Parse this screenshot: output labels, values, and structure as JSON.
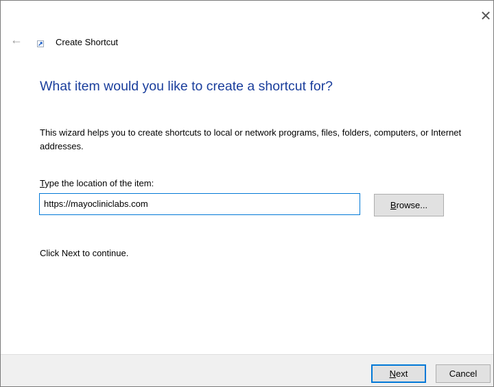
{
  "window": {
    "title": "Create Shortcut",
    "close_glyph": "✕",
    "back_glyph": "←"
  },
  "icons": {
    "back": "back-arrow-icon",
    "title": "shortcut-icon",
    "close": "close-icon"
  },
  "main": {
    "heading": "What item would you like to create a shortcut for?",
    "intro": "This wizard helps you to create shortcuts to local or network programs, files, folders, computers, or Internet addresses.",
    "field_label_mnemonic": "T",
    "field_label_rest": "ype the location of the item:",
    "location_value": "https://mayocliniclabs.com",
    "browse_mnemonic": "B",
    "browse_rest": "rowse...",
    "hint": "Click Next to continue."
  },
  "footer": {
    "next_mnemonic": "N",
    "next_rest": "ext",
    "cancel_label": "Cancel"
  },
  "colors": {
    "heading": "#1a3e9c",
    "accent": "#0078d7",
    "footer_bg": "#f0f0f0",
    "button_bg": "#e1e1e1"
  }
}
